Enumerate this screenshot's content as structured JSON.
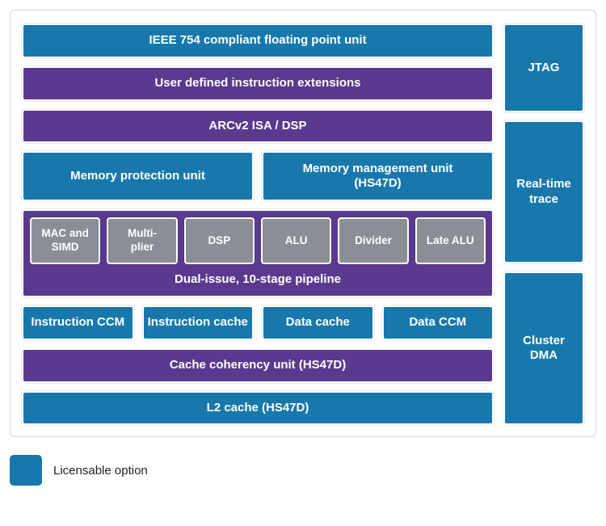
{
  "colors": {
    "blue": "#1878ab",
    "purple": "#5a3a8e",
    "gray": "#8a8f95"
  },
  "main": {
    "fpu": "IEEE 754 compliant floating point unit",
    "user_ext": "User defined instruction extensions",
    "isa": "ARCv2 ISA / DSP",
    "mpu": "Memory protection unit",
    "mmu": "Memory management unit\n(HS47D)",
    "pipeline": {
      "label": "Dual-issue, 10-stage pipeline",
      "units": [
        "MAC and SIMD",
        "Multi-\nplier",
        "DSP",
        "ALU",
        "Divider",
        "Late ALU"
      ]
    },
    "mem": [
      "Instruction CCM",
      "Instruction cache",
      "Data cache",
      "Data CCM"
    ],
    "ccu": "Cache coherency unit (HS47D)",
    "l2": "L2 cache (HS47D)"
  },
  "side": {
    "jtag": "JTAG",
    "rtt": "Real-time trace",
    "cdma": "Cluster DMA"
  },
  "legend": "Licensable option"
}
